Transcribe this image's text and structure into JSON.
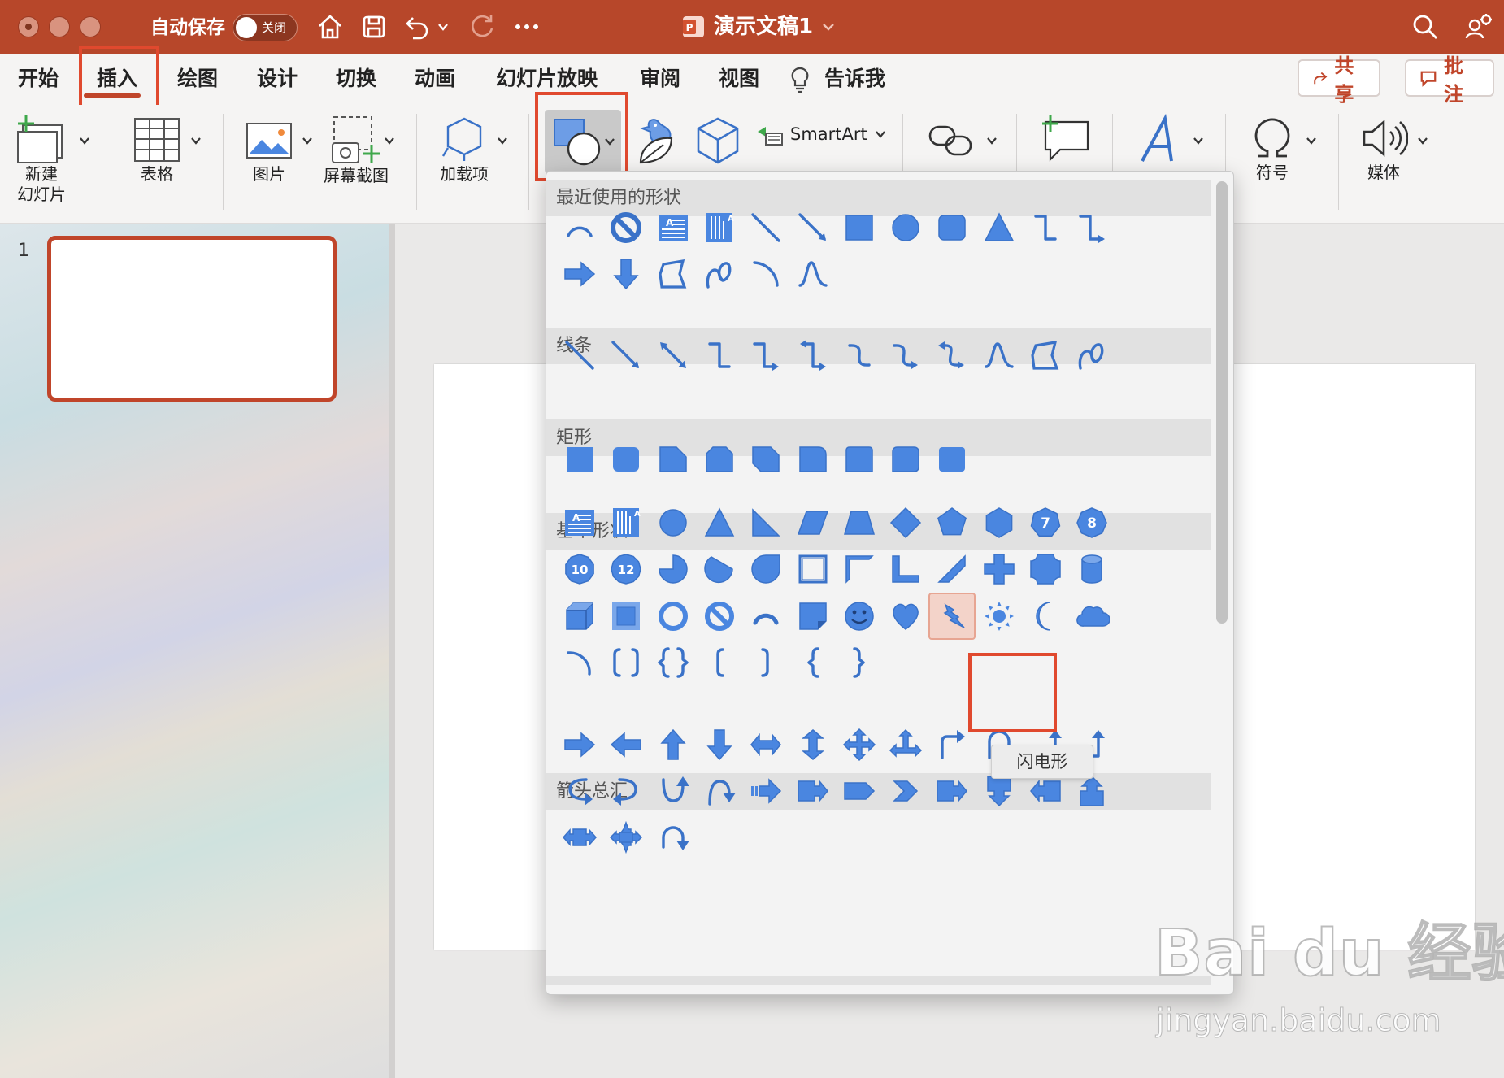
{
  "titlebar": {
    "autosave_label": "自动保存",
    "autosave_toggle": "关闭",
    "document_title": "演示文稿1",
    "icons": [
      "home-icon",
      "save-icon",
      "undo-icon",
      "redo-icon",
      "more-icon",
      "search-icon",
      "account-icon"
    ]
  },
  "menu": {
    "tabs": [
      {
        "label": "开始"
      },
      {
        "label": "插入"
      },
      {
        "label": "绘图"
      },
      {
        "label": "设计"
      },
      {
        "label": "切换"
      },
      {
        "label": "动画"
      },
      {
        "label": "幻灯片放映"
      },
      {
        "label": "审阅"
      },
      {
        "label": "视图"
      },
      {
        "label": "告诉我"
      }
    ],
    "active_tab": "插入",
    "share_label": "共享",
    "comment_label": "批注"
  },
  "ribbon": {
    "new_slide_line1": "新建",
    "new_slide_line2": "幻灯片",
    "table": "表格",
    "picture": "图片",
    "screenshot": "屏幕截图",
    "addins": "加载项",
    "smartart": "SmartArt",
    "symbol": "符号",
    "media": "媒体"
  },
  "thumbnails": {
    "slide_number": "1"
  },
  "shapes_gallery": {
    "sections": [
      {
        "title": "最近使用的形状"
      },
      {
        "title": "线条"
      },
      {
        "title": "矩形"
      },
      {
        "title": "基本形状"
      },
      {
        "title": "箭头总汇"
      }
    ],
    "basic_labels": {
      "octagon7": "7",
      "octagon8": "8",
      "decagon": "10",
      "dodecagon": "12"
    },
    "hovered_shape": "lightning-bolt",
    "tooltip": "闪电形"
  },
  "colors": {
    "accent": "#b7472a",
    "highlight": "#e0492e",
    "shape_fill": "#4a86e0",
    "shape_stroke": "#3a72c8"
  },
  "watermark": {
    "logo": "Bai du 经验",
    "url": "jingyan.baidu.com"
  }
}
